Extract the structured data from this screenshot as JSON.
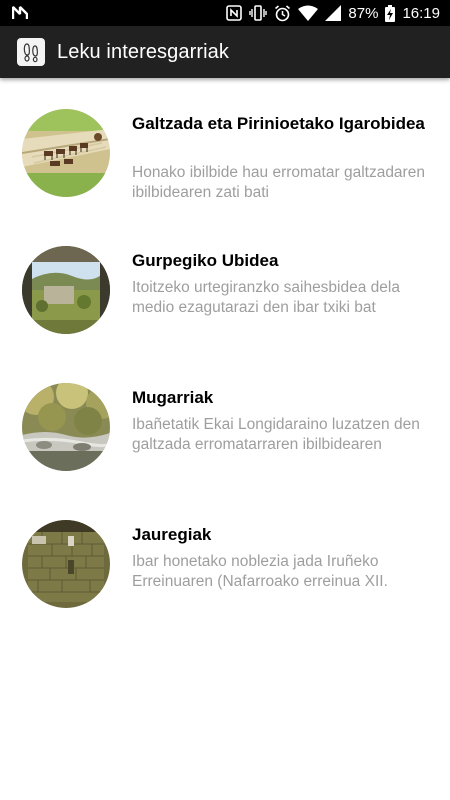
{
  "status_bar": {
    "battery": "87%",
    "time": "16:19",
    "icons": [
      "n-notification-icon",
      "nfc-icon",
      "vibrate-icon",
      "alarm-icon",
      "wifi-icon",
      "cellular-icon",
      "battery-charging-icon"
    ]
  },
  "app_bar": {
    "title": "Leku interesgarriak",
    "icon": "footprints-icon"
  },
  "items": [
    {
      "title": "Galtzada eta Pirinioetako Igarobidea",
      "description": "Honako ibilbide hau erromatar galtzadaren ibilbidearen zati bati"
    },
    {
      "title": "Gurpegiko Ubidea",
      "description": "Itoitzeko urtegiranzko saihesbidea dela medio ezagutarazi den ibar txiki bat"
    },
    {
      "title": "Mugarriak",
      "description": "Ibañetatik Ekai Longidaraino luzatzen den galtzada erromatarraren ibilbidearen"
    },
    {
      "title": "Jauregiak",
      "description": "Ibar honetako noblezia jada Iruñeko Erreinuaren (Nafarroako erreinua XII."
    }
  ],
  "colors": {
    "status_bar": "#000000",
    "app_bar": "#212121",
    "title_text": "#000000",
    "description_text": "#9e9e9e"
  }
}
